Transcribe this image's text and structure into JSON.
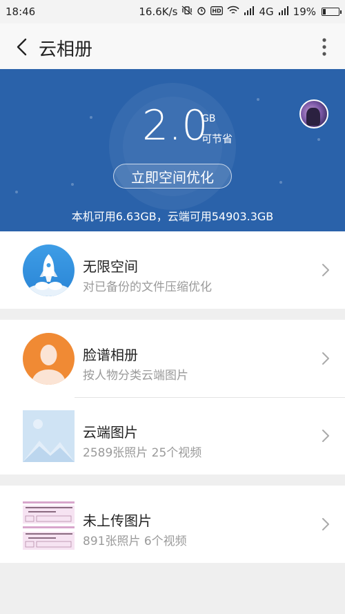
{
  "status_bar": {
    "time": "18:46",
    "network_speed": "16.6K/s",
    "network_type": "4G",
    "battery": "19%"
  },
  "title_bar": {
    "back_icon": "chevron-left-icon",
    "title": "云相册",
    "more_icon": "more-vertical-icon"
  },
  "banner": {
    "savings_value": "2.0",
    "savings_unit": "GB",
    "savings_label": "可节省",
    "optimize_button": "立即空间优化",
    "storage_info": "本机可用6.63GB，云端可用54903.3GB",
    "background_color": "#2a62aa"
  },
  "rows": [
    {
      "title": "无限空间",
      "subtitle": "对已备份的文件压缩优化",
      "icon": "rocket-icon"
    },
    {
      "title": "脸谱相册",
      "subtitle": "按人物分类云端图片",
      "icon": "person-icon"
    },
    {
      "title": "云端图片",
      "subtitle": "2589张照片 25个视频",
      "icon": "image-placeholder-icon"
    },
    {
      "title": "未上传图片",
      "subtitle": "891张照片 6个视频",
      "icon": "document-thumbnail"
    }
  ]
}
